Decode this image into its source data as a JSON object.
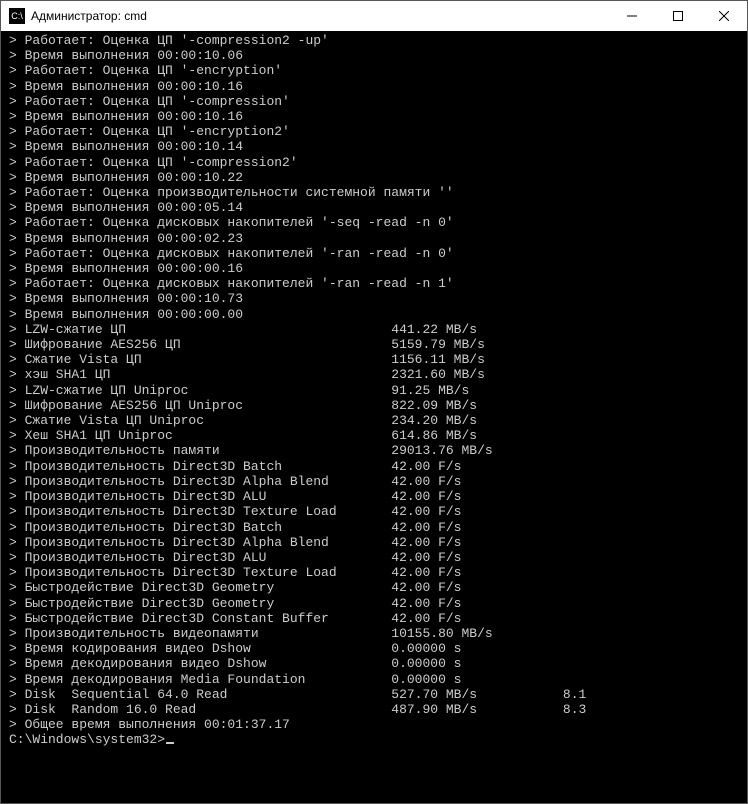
{
  "window": {
    "title": "Администратор: cmd",
    "icon_glyph": "C:\\"
  },
  "terminal": {
    "lines": [
      "> Работает: Оценка ЦП '-compression2 -up'",
      "> Время выполнения 00:00:10.06",
      "> Работает: Оценка ЦП '-encryption'",
      "> Время выполнения 00:00:10.16",
      "> Работает: Оценка ЦП '-compression'",
      "> Время выполнения 00:00:10.16",
      "> Работает: Оценка ЦП '-encryption2'",
      "> Время выполнения 00:00:10.14",
      "> Работает: Оценка ЦП '-compression2'",
      "> Время выполнения 00:00:10.22",
      "> Работает: Оценка производительности системной памяти ''",
      "> Время выполнения 00:00:05.14",
      "> Работает: Оценка дисковых накопителей '-seq -read -n 0'",
      "> Время выполнения 00:00:02.23",
      "> Работает: Оценка дисковых накопителей '-ran -read -n 0'",
      "> Время выполнения 00:00:00.16",
      "> Работает: Оценка дисковых накопителей '-ran -read -n 1'",
      "> Время выполнения 00:00:10.73",
      "> Время выполнения 00:00:00.00"
    ],
    "results": [
      {
        "label": "> LZW-сжатие ЦП",
        "value": "441.22 MB/s",
        "extra": ""
      },
      {
        "label": "> Шифрование AES256 ЦП",
        "value": "5159.79 MB/s",
        "extra": ""
      },
      {
        "label": "> Сжатие Vista ЦП",
        "value": "1156.11 MB/s",
        "extra": ""
      },
      {
        "label": "> хэш SHA1 ЦП",
        "value": "2321.60 MB/s",
        "extra": ""
      },
      {
        "label": "> LZW-сжатие ЦП Uniproc",
        "value": "91.25 MB/s",
        "extra": ""
      },
      {
        "label": "> Шифрование AES256 ЦП Uniproc",
        "value": "822.09 MB/s",
        "extra": ""
      },
      {
        "label": "> Сжатие Vista ЦП Uniproc",
        "value": "234.20 MB/s",
        "extra": ""
      },
      {
        "label": "> Хеш SHA1 ЦП Uniproc",
        "value": "614.86 MB/s",
        "extra": ""
      },
      {
        "label": "> Производительность памяти",
        "value": "29013.76 MB/s",
        "extra": ""
      },
      {
        "label": "> Производительность Direct3D Batch",
        "value": "42.00 F/s",
        "extra": ""
      },
      {
        "label": "> Производительность Direct3D Alpha Blend",
        "value": "42.00 F/s",
        "extra": ""
      },
      {
        "label": "> Производительность Direct3D ALU",
        "value": "42.00 F/s",
        "extra": ""
      },
      {
        "label": "> Производительность Direct3D Texture Load",
        "value": "42.00 F/s",
        "extra": ""
      },
      {
        "label": "> Производительность Direct3D Batch",
        "value": "42.00 F/s",
        "extra": ""
      },
      {
        "label": "> Производительность Direct3D Alpha Blend",
        "value": "42.00 F/s",
        "extra": ""
      },
      {
        "label": "> Производительность Direct3D ALU",
        "value": "42.00 F/s",
        "extra": ""
      },
      {
        "label": "> Производительность Direct3D Texture Load",
        "value": "42.00 F/s",
        "extra": ""
      },
      {
        "label": "> Быстродействие Direct3D Geometry",
        "value": "42.00 F/s",
        "extra": ""
      },
      {
        "label": "> Быстродействие Direct3D Geometry",
        "value": "42.00 F/s",
        "extra": ""
      },
      {
        "label": "> Быстродействие Direct3D Constant Buffer",
        "value": "42.00 F/s",
        "extra": ""
      },
      {
        "label": "> Производительность видеопамяти",
        "value": "10155.80 MB/s",
        "extra": ""
      },
      {
        "label": "> Время кодирования видео Dshow",
        "value": "0.00000 s",
        "extra": ""
      },
      {
        "label": "> Время декодирования видео Dshow",
        "value": "0.00000 s",
        "extra": ""
      },
      {
        "label": "> Время декодирования Media Foundation",
        "value": "0.00000 s",
        "extra": ""
      },
      {
        "label": "> Disk  Sequential 64.0 Read",
        "value": "527.70 MB/s",
        "extra": "8.1"
      },
      {
        "label": "> Disk  Random 16.0 Read",
        "value": "487.90 MB/s",
        "extra": "8.3"
      }
    ],
    "total_line": "> Общее время выполнения 00:01:37.17",
    "prompt": "C:\\Windows\\system32>"
  }
}
